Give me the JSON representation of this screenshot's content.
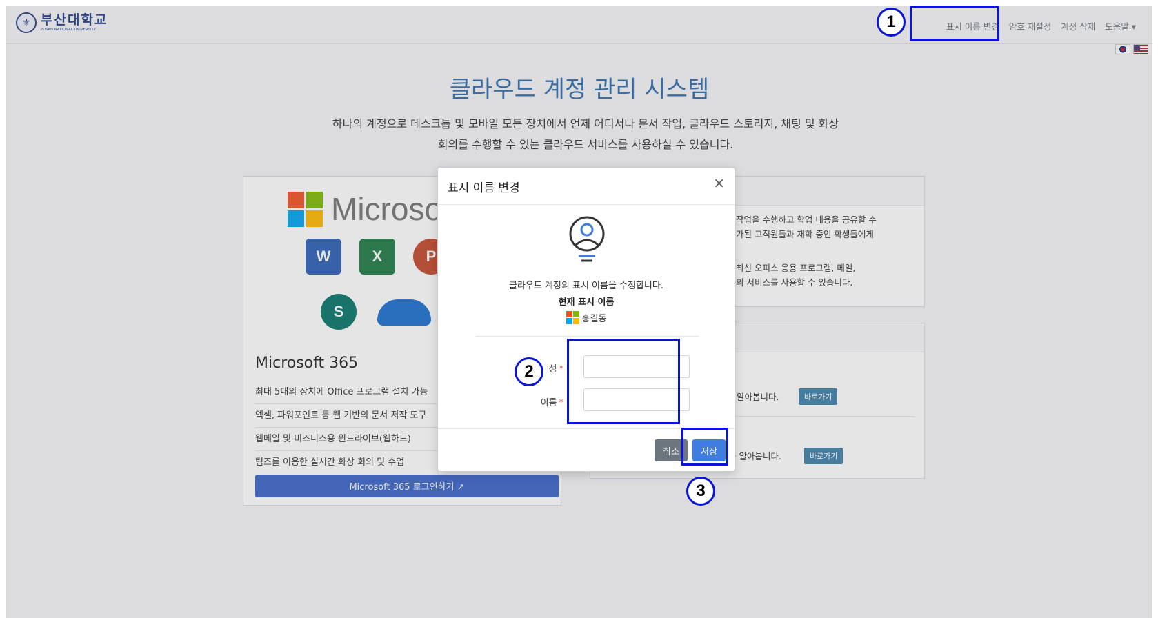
{
  "header": {
    "logo_ko": "부산대학교",
    "logo_en": "PUSAN NATIONAL UNIVERSITY",
    "nav": [
      "표시 이름 변경",
      "암호 재설정",
      "계정 삭제",
      "도움말 ▾"
    ]
  },
  "hero": {
    "title": "클라우드 계정 관리 시스템",
    "desc_line1": "하나의 계정으로 데스크톱 및 모바일 모든 장치에서 언제 어디서나 문서 작업, 클라우드 스토리지, 채팅 및 화상",
    "desc_line2": "회의를 수행할 수 있는 클라우드 서비스를 사용하실 수 있습니다."
  },
  "left_card": {
    "ms_text": "Microsoft",
    "apps": [
      "W",
      "X",
      "P",
      "S"
    ],
    "title": "Microsoft 365",
    "features": [
      "최대 5대의 장치에 Office 프로그램 설치 가능",
      "엑셀, 파워포인트 등 웹 기반의 문서 저작 도구",
      "웹메일 및 비즈니스용 원드라이브(웹하드)",
      "팀즈를 이용한 실시간 화상 회의 및 수업"
    ],
    "login_button": "Microsoft 365 로그인하기 ↗"
  },
  "right_card1": {
    "line1": "공동 작업을 수행하고 학업 내용을 공유할 수",
    "line2": "이 허가된 교직원들과 재학 중인 학생들에게",
    "line3": "반의 최신 오피스 응용 프로그램, 메일,",
    "line4": "의 등의 서비스를 사용할 수 있습니다."
  },
  "right_card2": {
    "row1_text": "알아봅니다.",
    "row2_text": "을 알아봅니다.",
    "go_label": "바로가기"
  },
  "modal": {
    "title": "표시 이름 변경",
    "close": "×",
    "description": "클라우드 계정의 표시 이름을 수정합니다.",
    "current_label": "현재 표시 이름",
    "current_name": "홍길동",
    "last_name_label": "성",
    "first_name_label": "이름",
    "required_mark": "*",
    "last_name_value": "",
    "first_name_value": "",
    "cancel": "취소",
    "save": "저장"
  },
  "annotations": [
    "1",
    "2",
    "3"
  ],
  "colors": {
    "accent": "#2f6eae",
    "primary_button": "#3f7de0",
    "annotation": "#0a15d8"
  }
}
